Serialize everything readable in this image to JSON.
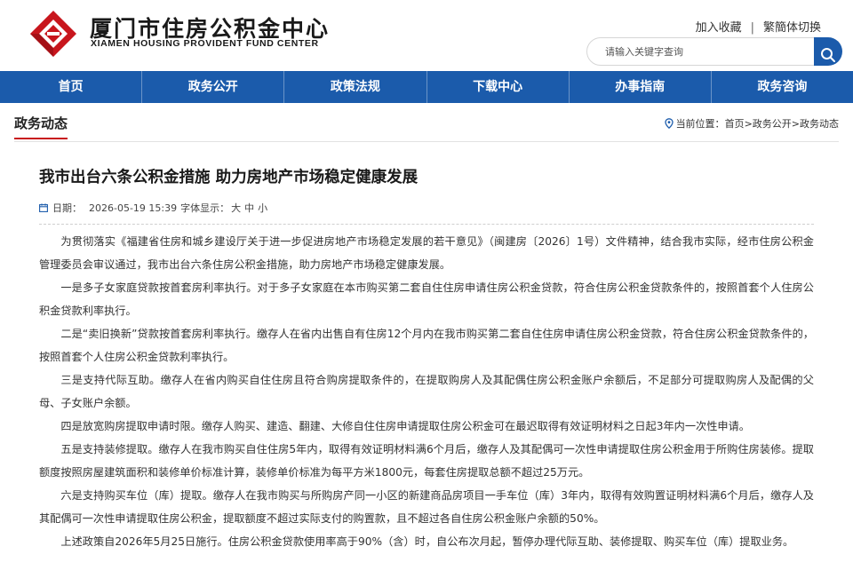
{
  "header": {
    "brand_cn": "厦门市住房公积金中心",
    "brand_en": "XIAMEN HOUSING PROVIDENT FUND CENTER",
    "links": {
      "favorite": "加入收藏",
      "separator": "|",
      "traditional": "繁簡体切换"
    },
    "search": {
      "placeholder": "请输入关键字查询"
    }
  },
  "nav": {
    "items": [
      {
        "label": "首页"
      },
      {
        "label": "政务公开"
      },
      {
        "label": "政策法规"
      },
      {
        "label": "下载中心"
      },
      {
        "label": "办事指南"
      },
      {
        "label": "政务咨询"
      }
    ]
  },
  "section": {
    "title": "政务动态",
    "breadcrumb": {
      "prefix": "当前位置：",
      "home": "首页",
      "sep": ">",
      "level1": "政务公开",
      "level2": "政务动态"
    }
  },
  "article": {
    "title": "我市出台六条公积金措施 助力房地产市场稳定健康发展",
    "date_label": "日期：",
    "date": "2026-05-19 15:39",
    "font_label": "字体显示：",
    "font_sizes": [
      "大",
      "中",
      "小"
    ],
    "paragraphs": [
      "为贯彻落实《福建省住房和城乡建设厅关于进一步促进房地产市场稳定发展的若干意见》（闽建房〔2026〕1号）文件精神，结合我市实际，经市住房公积金管理委员会审议通过，我市出台六条住房公积金措施，助力房地产市场稳定健康发展。",
      "一是多子女家庭贷款按首套房利率执行。对于多子女家庭在本市购买第二套自住住房申请住房公积金贷款，符合住房公积金贷款条件的，按照首套个人住房公积金贷款利率执行。",
      "二是“卖旧换新”贷款按首套房利率执行。缴存人在省内出售自有住房12个月内在我市购买第二套自住住房申请住房公积金贷款，符合住房公积金贷款条件的，按照首套个人住房公积金贷款利率执行。",
      "三是支持代际互助。缴存人在省内购买自住住房且符合购房提取条件的，在提取购房人及其配偶住房公积金账户余额后，不足部分可提取购房人及配偶的父母、子女账户余额。",
      "四是放宽购房提取申请时限。缴存人购买、建造、翻建、大修自住住房申请提取住房公积金可在最迟取得有效证明材料之日起3年内一次性申请。",
      "五是支持装修提取。缴存人在我市购买自住住房5年内，取得有效证明材料满6个月后，缴存人及其配偶可一次性申请提取住房公积金用于所购住房装修。提取额度按照房屋建筑面积和装修单价标准计算，装修单价标准为每平方米1800元，每套住房提取总额不超过25万元。",
      "六是支持购买车位（库）提取。缴存人在我市购买与所购房产同一小区的新建商品房项目一手车位（库）3年内，取得有效购置证明材料满6个月后，缴存人及其配偶可一次性申请提取住房公积金，提取额度不超过实际支付的购置款，且不超过各自住房公积金账户余额的50%。",
      "上述政策自2026年5月25日施行。住房公积金贷款使用率高于90%（含）时，自公布次月起，暂停办理代际互助、装修提取、购买车位（库）提取业务。"
    ]
  },
  "colors": {
    "primary": "#1b5bab",
    "accent": "#c8161d"
  }
}
